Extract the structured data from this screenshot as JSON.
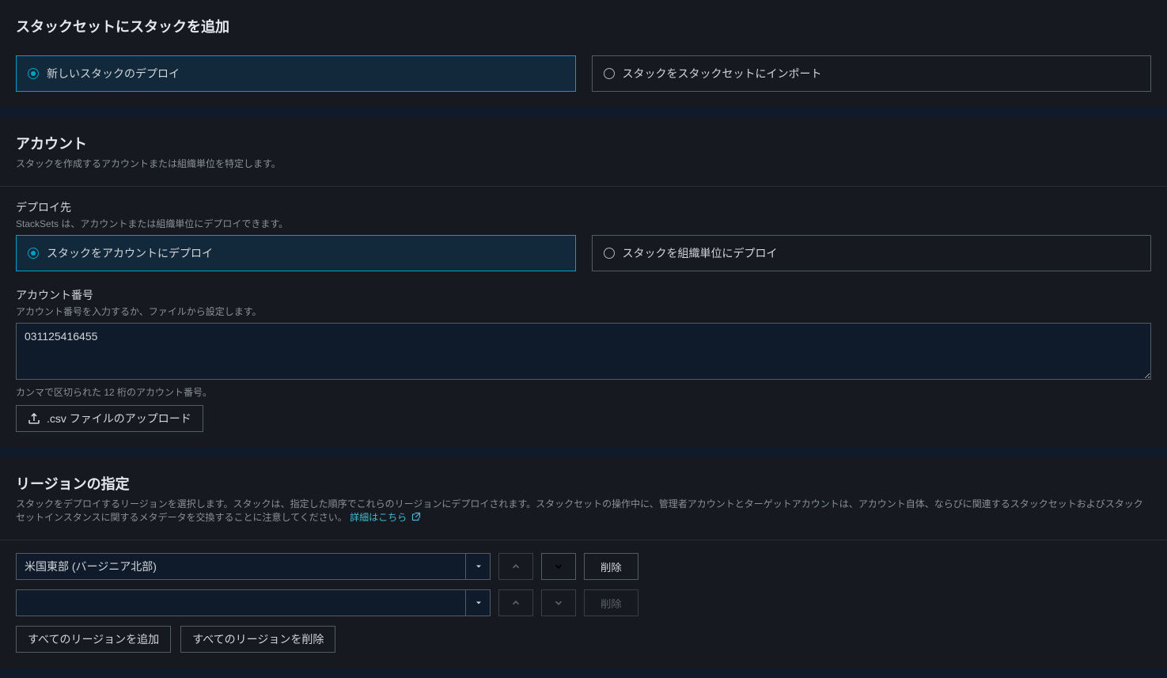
{
  "addStacks": {
    "title": "スタックセットにスタックを追加",
    "options": {
      "deploy_new": "新しいスタックのデプロイ",
      "import_existing": "スタックをスタックセットにインポート"
    }
  },
  "accounts": {
    "title": "アカウント",
    "subtitle": "スタックを作成するアカウントまたは組織単位を特定します。",
    "deploy_target_label": "デプロイ先",
    "deploy_target_sub": "StackSets は、アカウントまたは組織単位にデプロイできます。",
    "options": {
      "to_accounts": "スタックをアカウントにデプロイ",
      "to_ou": "スタックを組織単位にデプロイ"
    },
    "account_numbers_label": "アカウント番号",
    "account_numbers_sub": "アカウント番号を入力するか、ファイルから設定します。",
    "account_numbers_value": "031125416455",
    "account_numbers_helper": "カンマで区切られた 12 桁のアカウント番号。",
    "upload_csv_label": ".csv ファイルのアップロード"
  },
  "regions": {
    "title": "リージョンの指定",
    "subtitle_part1": "スタックをデプロイするリージョンを選択します。スタックは、指定した順序でこれらのリージョンにデプロイされます。スタックセットの操作中に、管理者アカウントとターゲットアカウントは、アカウント自体、ならびに関連するスタックセットおよびスタックセットインスタンスに関するメタデータを交換することに注意してください。 ",
    "learn_more": "詳細はこちら",
    "rows": [
      {
        "value": "米国東部 (バージニア北部)",
        "empty": false,
        "up_disabled": true,
        "down_disabled": false,
        "delete_disabled": false
      },
      {
        "value": "",
        "empty": true,
        "up_disabled": true,
        "down_disabled": true,
        "delete_disabled": true
      }
    ],
    "delete_label": "削除",
    "add_all_label": "すべてのリージョンを追加",
    "remove_all_label": "すべてのリージョンを削除"
  }
}
